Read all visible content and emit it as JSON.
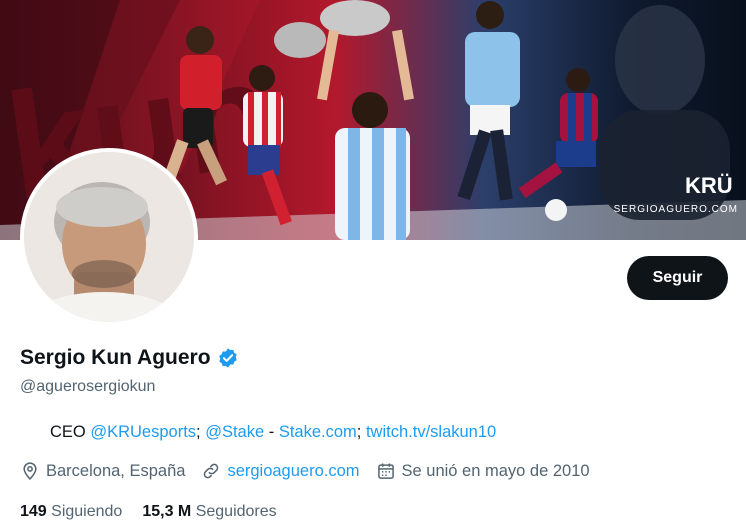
{
  "banner": {
    "brand": "SERGIOAGUERO.COM",
    "logo_text": "KRÜ",
    "side_text": "kun"
  },
  "profile": {
    "display_name": "Sergio Kun Aguero",
    "handle": "@aguerosergiokun",
    "verified_icon": "verified-badge-icon",
    "follow_label": "Seguir"
  },
  "bio": {
    "flag_icon": "argentina-flag-icon",
    "prefix": "CEO ",
    "mention_kru": "@KRUesports",
    "sep1": "; ",
    "mention_stake": "@Stake",
    "sep2": " - ",
    "stake_link": "Stake.com",
    "sep3": "; ",
    "twitch_link": "twitch.tv/slakun10"
  },
  "meta": {
    "location": "Barcelona, España",
    "website": "sergioaguero.com",
    "joined": "Se unió en mayo de 2010"
  },
  "counts": {
    "following_num": "149",
    "following_label": "Siguiendo",
    "followers_num": "15,3 M",
    "followers_label": "Seguidores"
  },
  "colors": {
    "accent": "#1d9bf0",
    "text": "#0f1419",
    "muted": "#536471",
    "button": "#0f1419"
  }
}
